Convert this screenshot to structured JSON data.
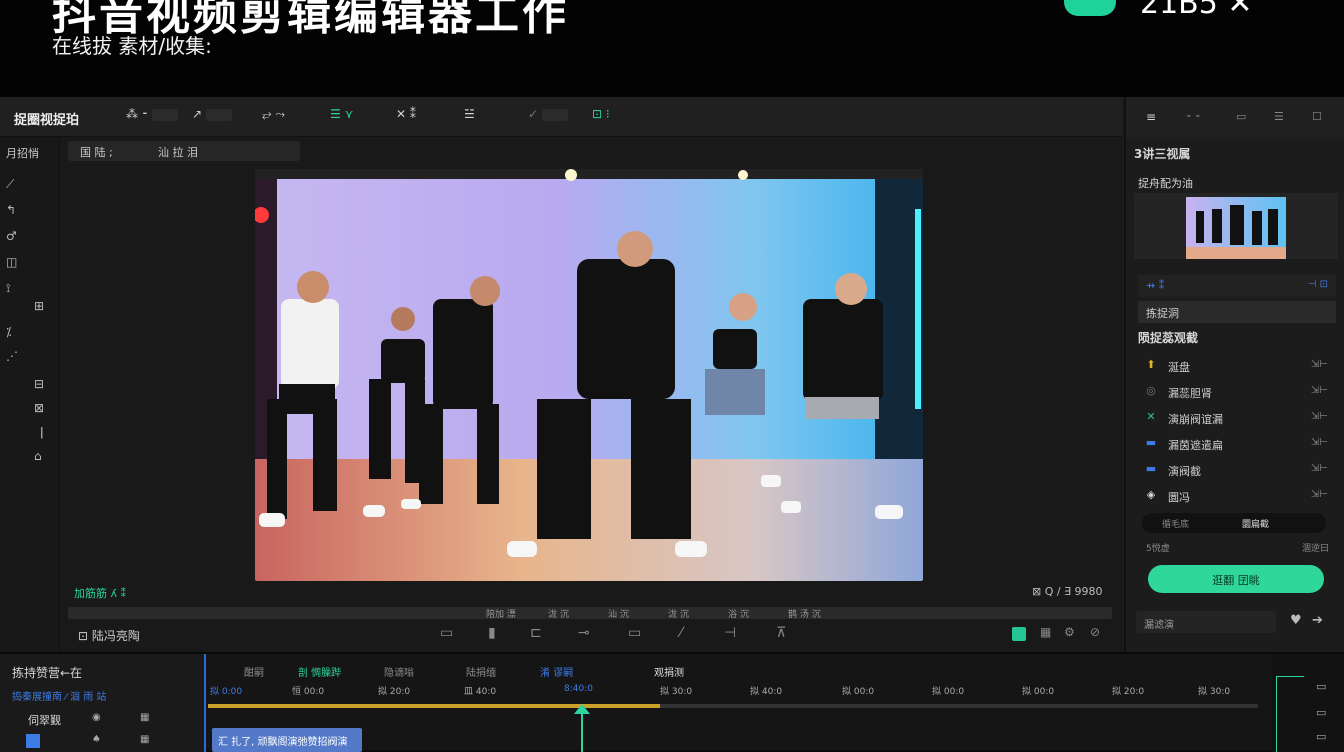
{
  "banner": {
    "title": "抖音视频剪辑编辑器工作",
    "subtitle": "在线拔 素材/收集:",
    "right_text": "21B5 ✕"
  },
  "toolbar": {
    "title": "捉圈视捉珀",
    "tools": [
      "⁂ ⁃",
      "↗",
      "⥂ ⤳",
      "☰ ⋎",
      "✕ ⁑",
      "☱",
      "✓",
      "⊡ ⁝"
    ]
  },
  "left_panel": {
    "title": "月招悄",
    "icons": [
      "⟋",
      "↰",
      "♂",
      "◫",
      "⟟",
      "⊞",
      "⁒",
      "⋰",
      "⊟",
      "⊠",
      "ǀ",
      "⌂"
    ]
  },
  "preview": {
    "tabs": [
      "国 陆 ;",
      "汕 拉 泪"
    ],
    "time_left": "加筋筋 ʎ ⁑",
    "time_right": "⊠ Q / ∃ 9980",
    "scrub_labels": [
      "陪加 漂",
      "泷 沉",
      "汕 沉",
      "泷 沉",
      "浴 沉",
      "鹊 汤 沉"
    ],
    "controls_label": "⊡ 陆冯亮陶",
    "controls": [
      "▭",
      "▮",
      "⊏",
      "⊸",
      "▭",
      "⁄",
      "⊣",
      "⊼"
    ]
  },
  "right_panel": {
    "top_icons": [
      "≡",
      "⁃ ⁃",
      "▭",
      "☰",
      "☐"
    ],
    "section1": "3讲三视属",
    "section2": "捉舟配为油",
    "row_a": "⇸ ⁑",
    "row_a_right": "⊣ ⊡",
    "row_b": "拣捉洞",
    "section3": "陨捉蕊观截",
    "items": [
      {
        "label": "涎盘",
        "tail": "⇲⊢",
        "icon": "⬆",
        "color": "#e6b422"
      },
      {
        "label": "漏蕊胆肾",
        "tail": "⇲⊢",
        "icon": "◎",
        "color": "#777777"
      },
      {
        "label": "演崩阀谊漏",
        "tail": "⇲⊢",
        "icon": "✕",
        "color": "#28c785"
      },
      {
        "label": "漏茵遮遣扁",
        "tail": "⇲⊢",
        "icon": "▬",
        "color": "#3d7be6"
      },
      {
        "label": "演阀截",
        "tail": "⇲⊢",
        "icon": "▬",
        "color": "#3d7be6"
      },
      {
        "label": "圜冯",
        "tail": "⇲⊢",
        "icon": "◈",
        "color": "#dddddd"
      }
    ],
    "switch_left": "循毛底",
    "switch_right": "圜扁截",
    "sub_left": "5悦虚",
    "sub_right": "涸逆曰",
    "export_button": "逛翻 囝眺",
    "footer_input": "漏滤演",
    "footer_icons": [
      "♥",
      "➔"
    ]
  },
  "timeline": {
    "header": "拣持赞营←在",
    "row1": "捣秦展撞南 ⁄ 涸 雨 站",
    "row2": "伺翠觐",
    "tabs": [
      "酣嗣",
      "剖 惆臊跸",
      "隐谪嗡",
      "陆捐缅",
      "淆 谬嗣",
      "观捐测"
    ],
    "ruler": [
      "拟 0:00",
      "恒 00:0",
      "拟 20:0",
      "皿 40:0",
      "8:40:0",
      "拟 30:0",
      "拟 40:0",
      "拟 00:0",
      "拟 00:0",
      "拟 00:0",
      "拟 20:0",
      "拟 30:0"
    ],
    "clip_label": "汇 扎了, 顽飘阁演弛赞招阀演"
  }
}
